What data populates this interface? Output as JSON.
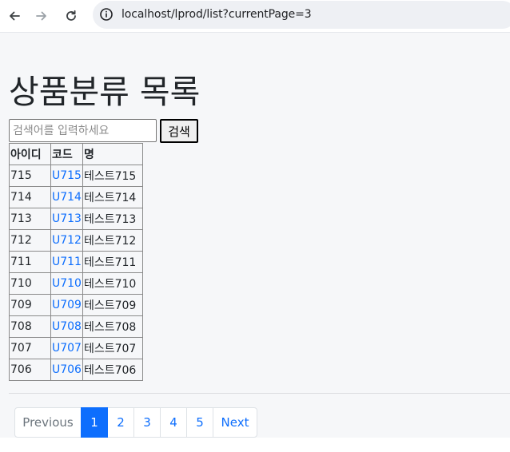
{
  "browser": {
    "url": "localhost/lprod/list?currentPage=3"
  },
  "page": {
    "title": "상품분류 목록",
    "search": {
      "placeholder": "검색어를 입력하세요",
      "value": "",
      "button_label": "검색"
    },
    "table": {
      "headers": [
        "아이디",
        "코드",
        "명"
      ],
      "rows": [
        {
          "id": "715",
          "code": "U715",
          "name": "테스트715"
        },
        {
          "id": "714",
          "code": "U714",
          "name": "테스트714"
        },
        {
          "id": "713",
          "code": "U713",
          "name": "테스트713"
        },
        {
          "id": "712",
          "code": "U712",
          "name": "테스트712"
        },
        {
          "id": "711",
          "code": "U711",
          "name": "테스트711"
        },
        {
          "id": "710",
          "code": "U710",
          "name": "테스트710"
        },
        {
          "id": "709",
          "code": "U709",
          "name": "테스트709"
        },
        {
          "id": "708",
          "code": "U708",
          "name": "테스트708"
        },
        {
          "id": "707",
          "code": "U707",
          "name": "테스트707"
        },
        {
          "id": "706",
          "code": "U706",
          "name": "테스트706"
        }
      ]
    },
    "pagination": {
      "previous_label": "Previous",
      "next_label": "Next",
      "pages": [
        "1",
        "2",
        "3",
        "4",
        "5"
      ],
      "active_page": "1"
    }
  },
  "colors": {
    "link": "#0d6efd",
    "active_page_bg": "#0d6efd",
    "page_bg": "#f6f7f9"
  }
}
